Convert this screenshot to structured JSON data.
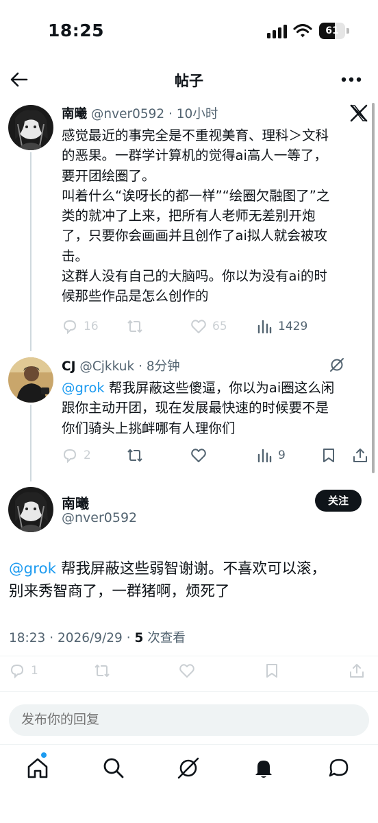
{
  "status_bar": {
    "time": "18:25",
    "battery": "61",
    "battery_level": 0.61
  },
  "header": {
    "title": "帖子"
  },
  "posts": [
    {
      "name": "南曦",
      "meta": "@nver0592 · 10小时",
      "lines": [
        "感觉最近的事完全是不重视美育、理科＞文科",
        "的恶果。一群学计算机的觉得ai高人一等了，",
        "要开团绘圈了。",
        "叫着什么“诶呀长的都一样”“绘圈欠融图了”之",
        "类的就冲了上来，把所有人老师无差别开炮",
        "了，只要你会画画并且创作了ai拟人就会被攻",
        "击。",
        "这群人没有自己的大脑吗。你以为没有ai的时",
        "候那些作品是怎么创作的"
      ],
      "replies": "16",
      "likes": "65",
      "views": "1429"
    },
    {
      "name": "CJ",
      "meta": "@Cjkkuk · 8分钟",
      "mention": "@grok",
      "lines": [
        " 帮我屏蔽这些傻逼，你以为ai圈这么闲",
        "跟你主动开团，现在发展最快速的时候要不是",
        "你们骑头上挑衅哪有人理你们"
      ],
      "replies": "2",
      "views": "9"
    }
  ],
  "main_post": {
    "name": "南曦",
    "handle": "@nver0592",
    "follow_label": "关注",
    "mention": "@grok",
    "line1_rest": " 帮我屏蔽这些弱智谢谢。不喜欢可以滚，",
    "line2": "别来秀智商了，一群猪啊，烦死了",
    "timestamp": "18:23 · 2026/9/29 · ",
    "views_count": "5",
    "views_label": " 次查看",
    "replies": "1"
  },
  "reply_box": {
    "placeholder": "发布你的回复"
  },
  "icons": {
    "back": "back-arrow-icon",
    "more": "more-dots-icon",
    "x_logo": "x-logo-icon",
    "grok": "grok-icon",
    "reply": "reply-icon",
    "repost": "repost-icon",
    "like": "like-icon",
    "views": "views-icon",
    "bookmark": "bookmark-icon",
    "share": "share-icon"
  },
  "colors": {
    "accent": "#1d9bf0",
    "text": "#0f1419",
    "muted": "#536471"
  }
}
